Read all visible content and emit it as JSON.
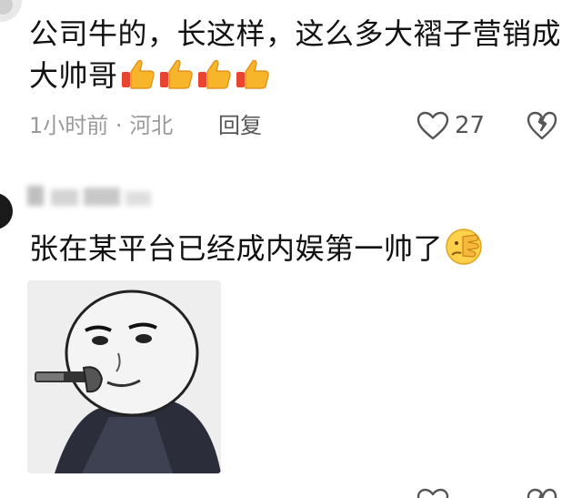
{
  "comments": [
    {
      "text": "公司牛的，长这样，这么多大褶子营销成大帅哥",
      "emoji": [
        "thumbs-up",
        "thumbs-up",
        "thumbs-up",
        "thumbs-up"
      ],
      "time": "1小时前",
      "location": "河北",
      "reply_label": "回复",
      "likes": "27"
    },
    {
      "username": "",
      "text": "张在某平台已经成内娱第一帅了",
      "emoji": [
        "facepalm"
      ],
      "image": "meme-face-phone",
      "time": "",
      "location": "",
      "reply_label": "",
      "likes": ""
    }
  ],
  "separator": "·"
}
